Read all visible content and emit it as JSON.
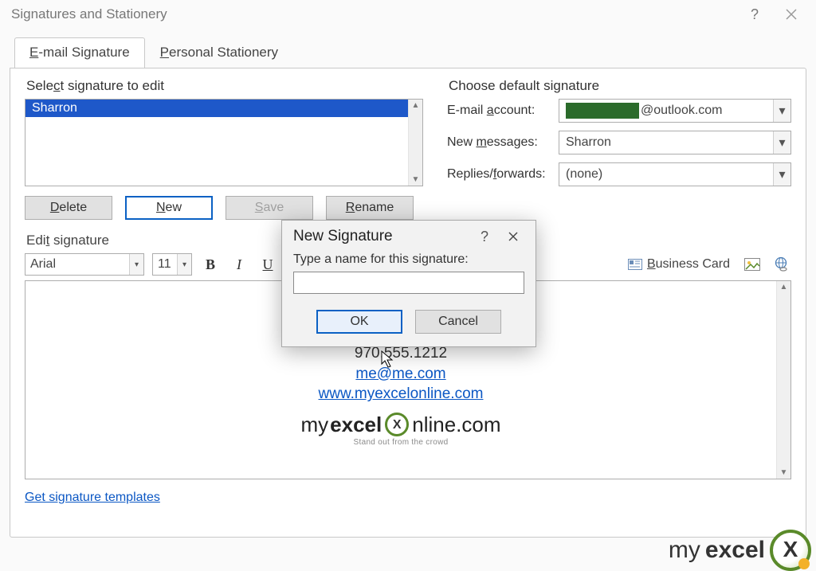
{
  "window": {
    "title": "Signatures and Stationery"
  },
  "tabs": {
    "email_signature": "E-mail Signature",
    "personal_stationery": "Personal Stationery"
  },
  "left": {
    "select_label": "Select signature to edit",
    "list_item": "Sharron",
    "buttons": {
      "delete": "Delete",
      "new": "New",
      "save": "Save",
      "rename": "Rename"
    }
  },
  "right": {
    "choose_label": "Choose default signature",
    "account_label": "E-mail account:",
    "account_value": "@outlook.com",
    "new_msgs_label": "New messages:",
    "new_msgs_value": "Sharron",
    "replies_label": "Replies/forwards:",
    "replies_value": "(none)"
  },
  "edit": {
    "label": "Edit signature",
    "font": "Arial",
    "size": "11",
    "business_card": "Business Card",
    "content_phone": "970.555.1212",
    "content_email": "me@me.com",
    "content_url": "www.myexcelonline.com",
    "logo_left": "myexcel",
    "logo_right": "nline.com",
    "tagline": "Stand out from the crowd"
  },
  "templates_link": "Get signature templates",
  "modal": {
    "title": "New Signature",
    "prompt": "Type a name for this signature:",
    "value": "",
    "ok": "OK",
    "cancel": "Cancel"
  },
  "watermark": {
    "left": "my",
    "right": "excel"
  }
}
